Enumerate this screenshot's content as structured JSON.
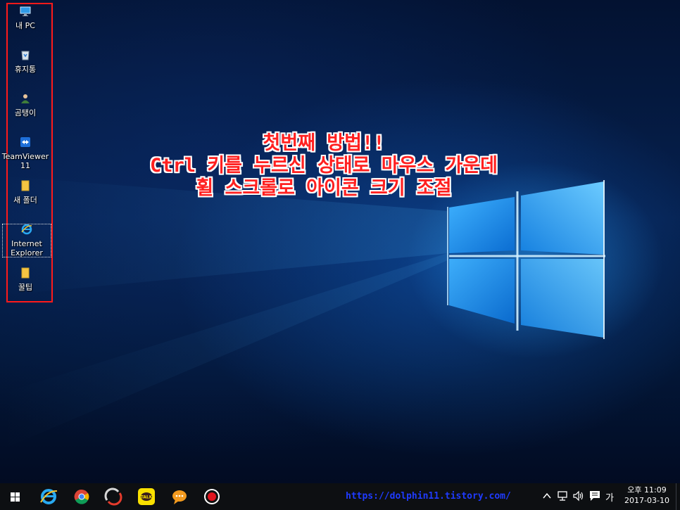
{
  "desktop": {
    "icons": [
      {
        "label": "내 PC",
        "icon": "this-pc-icon"
      },
      {
        "label": "휴지통",
        "icon": "recycle-bin-icon"
      },
      {
        "label": "곰탱이",
        "icon": "user-folder-icon"
      },
      {
        "label": "TeamViewer 11",
        "icon": "teamviewer-icon"
      },
      {
        "label": "새 폴더",
        "icon": "folder-icon"
      },
      {
        "label": "Internet Explorer",
        "icon": "internet-explorer-icon"
      },
      {
        "label": "꿀팁",
        "icon": "folder-icon"
      }
    ],
    "annotation": {
      "line1": "첫번째 방법!!",
      "line2": "Ctrl 키를 누르신 상태로 마우스 가운데",
      "line3": "휠 스크롤로 아이콘 크기 조절"
    },
    "highlight_color": "#ff1a1a"
  },
  "taskbar": {
    "pinned": [
      {
        "name": "start-button",
        "icon": "windows-logo-icon"
      },
      {
        "name": "internet-explorer",
        "icon": "internet-explorer-icon"
      },
      {
        "name": "chrome",
        "icon": "chrome-icon"
      },
      {
        "name": "app-swirl",
        "icon": "swirl-app-icon"
      },
      {
        "name": "kakaotalk",
        "icon": "kakaotalk-icon",
        "text": "TALK"
      },
      {
        "name": "chat-app",
        "icon": "speech-bubble-icon"
      },
      {
        "name": "recorder",
        "icon": "record-icon"
      }
    ],
    "url": "https://dolphin11.tistory.com/",
    "tray": {
      "ime": "가",
      "time": "오후 11:09",
      "date": "2017-03-10"
    }
  }
}
